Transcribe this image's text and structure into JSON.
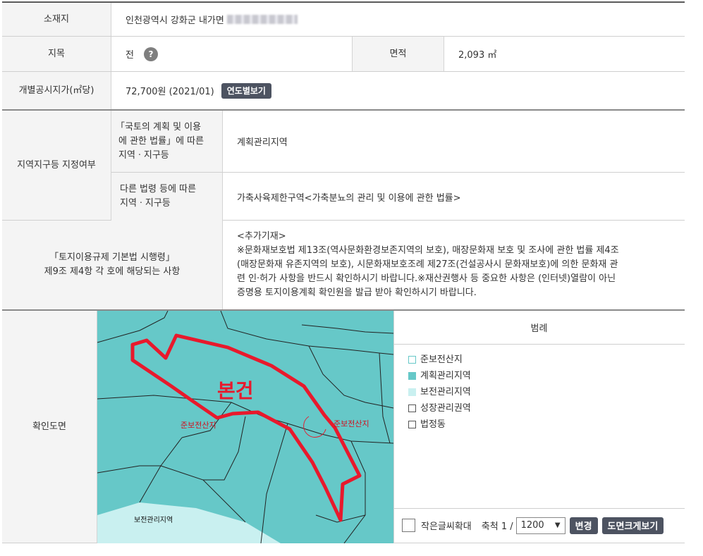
{
  "location": {
    "label": "소재지",
    "address": "인천광역시 강화군 내가면"
  },
  "land": {
    "label": "지목",
    "value": "전",
    "help_glyph": "?",
    "area_label": "면적",
    "area_value": "2,093 ㎡"
  },
  "price": {
    "label": "개별공시지가(㎡당)",
    "value": "72,700원 (2021/01)",
    "button": "연도별보기"
  },
  "zoning": {
    "label": "지역지구등 지정여부",
    "national_label": [
      "「국토의 계획 및 이용",
      "에 관한 법률」에 따른",
      "지역ㆍ지구등"
    ],
    "national_value": "계획관리지역",
    "other_label": [
      "다른 법령 등에 따른",
      "지역ㆍ지구등"
    ],
    "other_value": "가축사육제한구역<가축분뇨의 관리 및 이용에 관한 법률>"
  },
  "regulation": {
    "label": [
      "「토지이용규제 기본법 시행령」",
      "제9조 제4항 각 호에 해당되는 사항"
    ],
    "lines": [
      "<추가기재>",
      "※문화재보호법 제13조(역사문화환경보존지역의 보호), 매장문화재 보호 및 조사에 관한 법률 제4조",
      "(매장문화재 유존지역의 보호), 시문화재보호조례 제27조(건설공사시 문화재보호)에 의한 문화재 관",
      "련 인·허가 사항을 반드시 확인하시기 바랍니다.※재산권행사 등 중요한 사항은 (인터넷)열람이 아닌",
      "증명용 토지이용계획 확인원을 발급 받아 확인하시기 바랍니다."
    ]
  },
  "map": {
    "label": "확인도면",
    "parcel_label": "본건",
    "zone_label_1": "준보전산지",
    "zone_label_2": "준보전산지",
    "bottom_label": "보전관리지역",
    "colors": {
      "planned": "#66c8c8",
      "conservation": "#c9f0f0",
      "boundary": "#e8192c"
    }
  },
  "legend": {
    "title": "범례",
    "items": [
      {
        "label": "준보전산지",
        "color": "#ffffff",
        "border": "#66c8c8"
      },
      {
        "label": "계획관리지역",
        "color": "#66c8c8",
        "border": "#66c8c8"
      },
      {
        "label": "보전관리지역",
        "color": "#c9f0f0",
        "border": "#c9f0f0"
      },
      {
        "label": "성장관리권역",
        "color": "#ffffff",
        "border": "#555555"
      },
      {
        "label": "법정동",
        "color": "#ffffff",
        "border": "#555555"
      }
    ]
  },
  "toolbar": {
    "small_text_label": "작은글씨확대",
    "scale_label": "축척 1 /",
    "scale_value": "1200",
    "change_button": "변경",
    "enlarge_button": "도면크게보기"
  }
}
